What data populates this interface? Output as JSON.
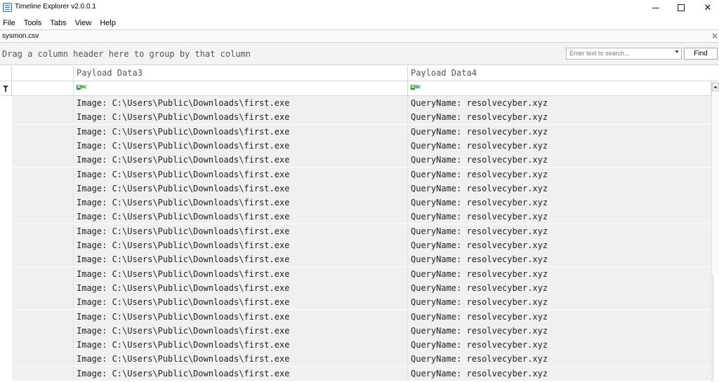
{
  "window": {
    "title": "Timeline Explorer v2.0.0.1"
  },
  "menu": [
    {
      "label": "File"
    },
    {
      "label": "Tools"
    },
    {
      "label": "Tabs"
    },
    {
      "label": "View"
    },
    {
      "label": "Help"
    }
  ],
  "tab": {
    "label": "sysmon.csv",
    "close": "×"
  },
  "groupbar": {
    "hint": "Drag a column header here to group by that column",
    "search_placeholder": "Enter text to search...",
    "find_label": "Find"
  },
  "grid": {
    "columns": [
      "",
      "",
      "Payload Data3",
      "Payload Data4"
    ],
    "rows": [
      {
        "data3": "Image: C:\\Users\\Public\\Downloads\\first.exe",
        "data4": "QueryName: resolvecyber.xyz"
      },
      {
        "data3": "Image: C:\\Users\\Public\\Downloads\\first.exe",
        "data4": "QueryName: resolvecyber.xyz"
      },
      {
        "data3": "Image: C:\\Users\\Public\\Downloads\\first.exe",
        "data4": "QueryName: resolvecyber.xyz"
      },
      {
        "data3": "Image: C:\\Users\\Public\\Downloads\\first.exe",
        "data4": "QueryName: resolvecyber.xyz"
      },
      {
        "data3": "Image: C:\\Users\\Public\\Downloads\\first.exe",
        "data4": "QueryName: resolvecyber.xyz"
      },
      {
        "data3": "Image: C:\\Users\\Public\\Downloads\\first.exe",
        "data4": "QueryName: resolvecyber.xyz"
      },
      {
        "data3": "Image: C:\\Users\\Public\\Downloads\\first.exe",
        "data4": "QueryName: resolvecyber.xyz"
      },
      {
        "data3": "Image: C:\\Users\\Public\\Downloads\\first.exe",
        "data4": "QueryName: resolvecyber.xyz"
      },
      {
        "data3": "Image: C:\\Users\\Public\\Downloads\\first.exe",
        "data4": "QueryName: resolvecyber.xyz"
      },
      {
        "data3": "Image: C:\\Users\\Public\\Downloads\\first.exe",
        "data4": "QueryName: resolvecyber.xyz"
      },
      {
        "data3": "Image: C:\\Users\\Public\\Downloads\\first.exe",
        "data4": "QueryName: resolvecyber.xyz"
      },
      {
        "data3": "Image: C:\\Users\\Public\\Downloads\\first.exe",
        "data4": "QueryName: resolvecyber.xyz"
      },
      {
        "data3": "Image: C:\\Users\\Public\\Downloads\\first.exe",
        "data4": "QueryName: resolvecyber.xyz"
      },
      {
        "data3": "Image: C:\\Users\\Public\\Downloads\\first.exe",
        "data4": "QueryName: resolvecyber.xyz"
      },
      {
        "data3": "Image: C:\\Users\\Public\\Downloads\\first.exe",
        "data4": "QueryName: resolvecyber.xyz"
      },
      {
        "data3": "Image: C:\\Users\\Public\\Downloads\\first.exe",
        "data4": "QueryName: resolvecyber.xyz"
      },
      {
        "data3": "Image: C:\\Users\\Public\\Downloads\\first.exe",
        "data4": "QueryName: resolvecyber.xyz"
      },
      {
        "data3": "Image: C:\\Users\\Public\\Downloads\\first.exe",
        "data4": "QueryName: resolvecyber.xyz"
      },
      {
        "data3": "Image: C:\\Users\\Public\\Downloads\\first.exe",
        "data4": "QueryName: resolvecyber.xyz"
      },
      {
        "data3": "Image: C:\\Users\\Public\\Downloads\\first.exe",
        "data4": "QueryName: resolvecyber.xyz"
      }
    ]
  }
}
